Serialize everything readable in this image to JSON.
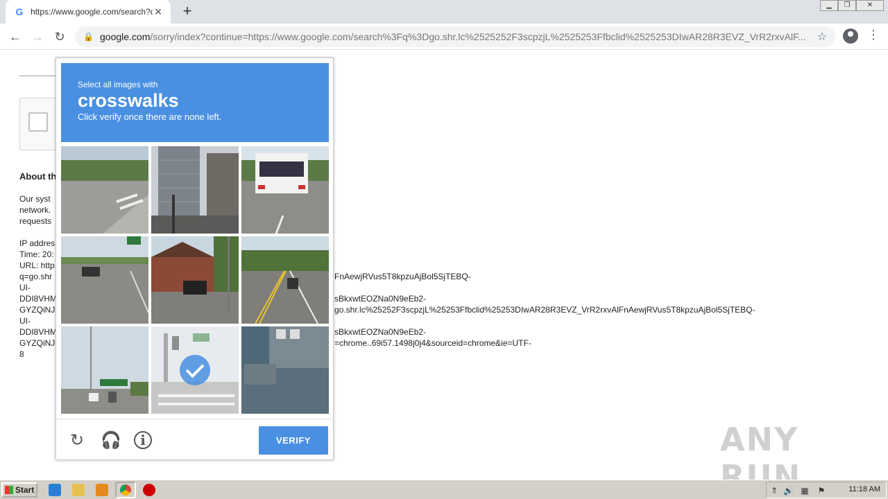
{
  "browser": {
    "tab_title": "https://www.google.com/search?q=",
    "tab_favicon": "G",
    "url_host": "google.com",
    "url_path": "/sorry/index?continue=https://www.google.com/search%3Fq%3Dgo.shr.lc%2525252F3scpzjL%2525253Ffbclid%2525253DIwAR28R3EVZ_VrR2rxvAlF..."
  },
  "page": {
    "about_heading": "About th",
    "para1": [
      "Our syst",
      "network.",
      "requests"
    ],
    "ip_block": [
      "IP addres",
      "Time: 20:",
      "URL: http",
      "q=go.shr",
      "UI-",
      "DDI8VHM",
      "GYZQiNJ",
      "UI-",
      "DDI8VHM",
      "GYZQiNJ",
      "8"
    ],
    "right_lines": [
      "FnAewjRVus5T8kpzuAjBol5SjTEBQ-",
      "sBkxwtEOZNa0N9eEb2-",
      "go.shr.lc%25252F3scpzjL%25253Ffbclid%25253DIwAR28R3EVZ_VrR2rxvAlFnAewjRVus5T8kpzuAjBol5SjTEBQ-",
      "sBkxwtEOZNa0N9eEb2-",
      "=chrome..69i57.1498j0j4&sourceid=chrome&ie=UTF-"
    ]
  },
  "captcha": {
    "select_text": "Select all images with",
    "keyword": "crosswalks",
    "instruction": "Click verify once there are none left.",
    "verify_label": "VERIFY",
    "accent": "#4a90e2"
  },
  "watermark": "ANY RUN",
  "taskbar": {
    "start_label": "Start",
    "clock": "11:18 AM"
  }
}
